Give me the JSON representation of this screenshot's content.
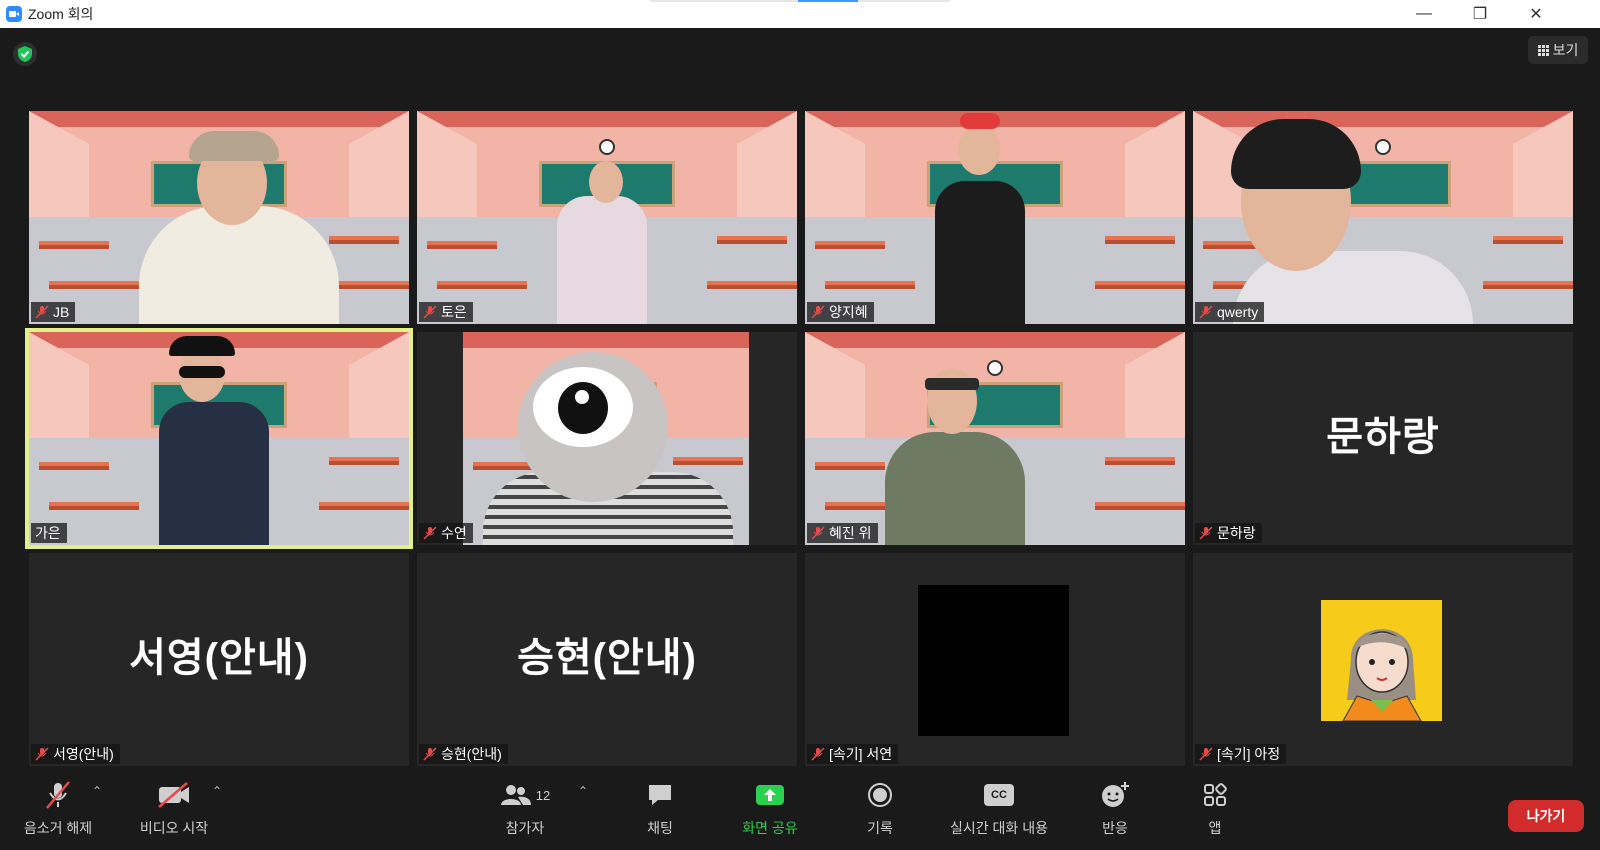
{
  "window": {
    "title": "Zoom 회의",
    "minimize": "—",
    "maximize": "❐",
    "close": "✕"
  },
  "view_button": {
    "label": "보기",
    "icon": "grid-icon"
  },
  "security_icon": "shield-check-icon",
  "participants": [
    {
      "name": "JB",
      "muted": true,
      "video": true
    },
    {
      "name": "토은",
      "muted": true,
      "video": true
    },
    {
      "name": "양지혜",
      "muted": true,
      "video": true
    },
    {
      "name": "qwerty",
      "muted": true,
      "video": true
    },
    {
      "name": "가은",
      "muted": false,
      "video": true,
      "active_speaker": true
    },
    {
      "name": "수연",
      "muted": true,
      "video": true
    },
    {
      "name": "혜진 위",
      "muted": true,
      "video": true
    },
    {
      "name": "문하랑",
      "muted": true,
      "video": false,
      "display_name": "문하랑"
    },
    {
      "name": "서영(안내)",
      "muted": true,
      "video": false,
      "display_name": "서영(안내)"
    },
    {
      "name": "승현(안내)",
      "muted": true,
      "video": false,
      "display_name": "승현(안내)"
    },
    {
      "name": "[속기] 서연",
      "muted": true,
      "video": false,
      "avatar": "black-square"
    },
    {
      "name": "[속기] 아정",
      "muted": true,
      "video": false,
      "avatar": "cartoon-portrait"
    }
  ],
  "toolbar": {
    "unmute": "음소거 해제",
    "start_video": "비디오 시작",
    "participants": "참가자",
    "participants_count": "12",
    "chat": "채팅",
    "share_screen": "화면 공유",
    "record": "기록",
    "live_transcript": "실시간 대화 내용",
    "reactions": "반응",
    "apps": "앱",
    "leave": "나가기",
    "cc_text": "CC"
  },
  "colors": {
    "background": "#1a1a1a",
    "tile": "#262626",
    "speaker_border": "#e3ef8a",
    "share_green": "#2ad14e",
    "leave_red": "#d12b2b",
    "mute_red": "#e84a4a"
  }
}
